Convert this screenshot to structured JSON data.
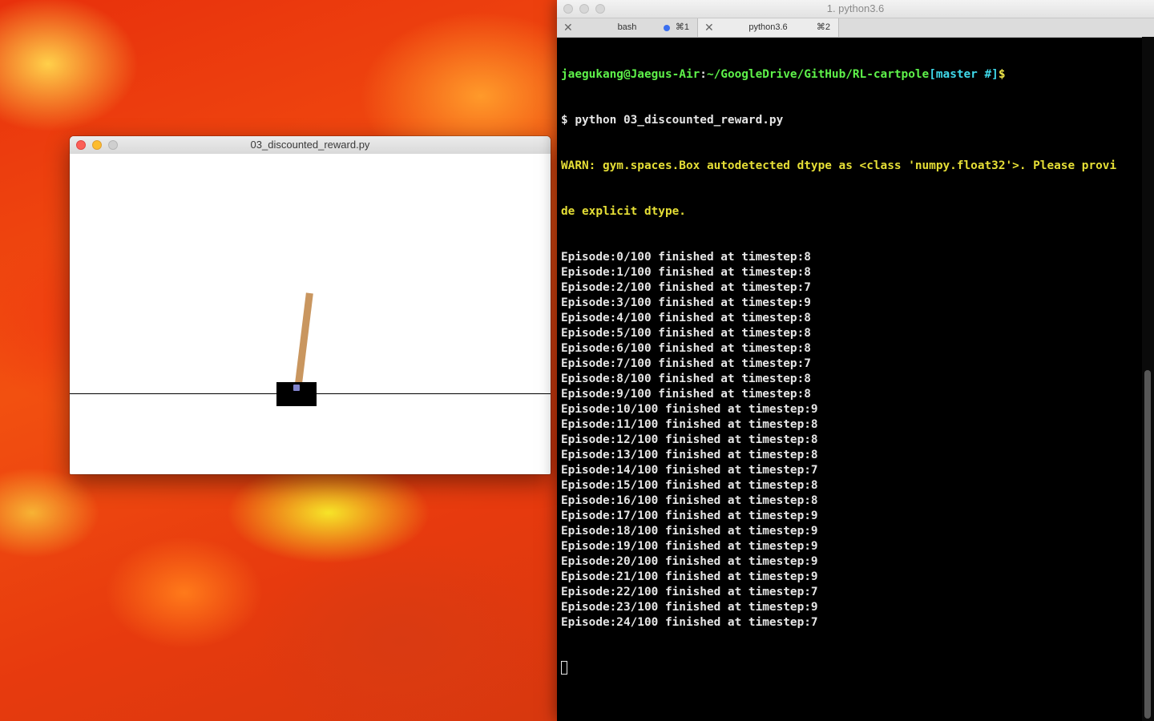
{
  "python_window": {
    "title": "03_discounted_reward.py"
  },
  "terminal": {
    "window_title": "1. python3.6",
    "tabs": [
      {
        "label": "bash",
        "shortcut": "⌘1",
        "active": false
      },
      {
        "label": "python3.6",
        "shortcut": "⌘2",
        "active": true
      }
    ],
    "prompt": {
      "user_host": "jaegukang@Jaegus-Air",
      "colon": ":",
      "path": "~/GoogleDrive/GitHub/RL-cartpole",
      "branch": "[master #]",
      "dollar": "$"
    },
    "command": "$ python 03_discounted_reward.py",
    "warn_line1": "WARN: gym.spaces.Box autodetected dtype as <class 'numpy.float32'>. Please provi",
    "warn_line2": "de explicit dtype.",
    "output_lines": [
      "Episode:0/100 finished at timestep:8",
      "Episode:1/100 finished at timestep:8",
      "Episode:2/100 finished at timestep:7",
      "Episode:3/100 finished at timestep:9",
      "Episode:4/100 finished at timestep:8",
      "Episode:5/100 finished at timestep:8",
      "Episode:6/100 finished at timestep:8",
      "Episode:7/100 finished at timestep:7",
      "Episode:8/100 finished at timestep:8",
      "Episode:9/100 finished at timestep:8",
      "Episode:10/100 finished at timestep:9",
      "Episode:11/100 finished at timestep:8",
      "Episode:12/100 finished at timestep:8",
      "Episode:13/100 finished at timestep:8",
      "Episode:14/100 finished at timestep:7",
      "Episode:15/100 finished at timestep:8",
      "Episode:16/100 finished at timestep:8",
      "Episode:17/100 finished at timestep:9",
      "Episode:18/100 finished at timestep:9",
      "Episode:19/100 finished at timestep:9",
      "Episode:20/100 finished at timestep:9",
      "Episode:21/100 finished at timestep:9",
      "Episode:22/100 finished at timestep:7",
      "Episode:23/100 finished at timestep:9",
      "Episode:24/100 finished at timestep:7"
    ]
  }
}
